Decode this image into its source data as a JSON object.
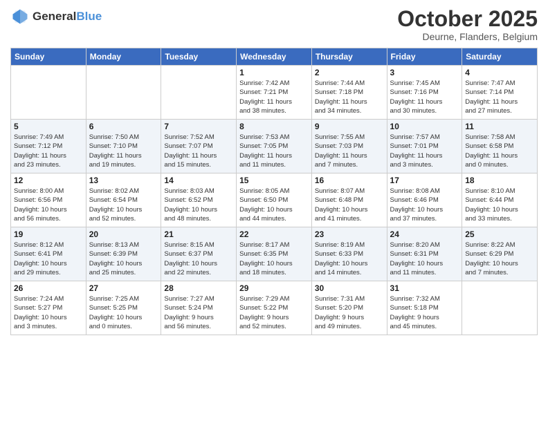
{
  "header": {
    "logo_line1": "General",
    "logo_line2": "Blue",
    "month_title": "October 2025",
    "subtitle": "Deurne, Flanders, Belgium"
  },
  "weekdays": [
    "Sunday",
    "Monday",
    "Tuesday",
    "Wednesday",
    "Thursday",
    "Friday",
    "Saturday"
  ],
  "weeks": [
    [
      {
        "day": "",
        "info": ""
      },
      {
        "day": "",
        "info": ""
      },
      {
        "day": "",
        "info": ""
      },
      {
        "day": "1",
        "info": "Sunrise: 7:42 AM\nSunset: 7:21 PM\nDaylight: 11 hours\nand 38 minutes."
      },
      {
        "day": "2",
        "info": "Sunrise: 7:44 AM\nSunset: 7:18 PM\nDaylight: 11 hours\nand 34 minutes."
      },
      {
        "day": "3",
        "info": "Sunrise: 7:45 AM\nSunset: 7:16 PM\nDaylight: 11 hours\nand 30 minutes."
      },
      {
        "day": "4",
        "info": "Sunrise: 7:47 AM\nSunset: 7:14 PM\nDaylight: 11 hours\nand 27 minutes."
      }
    ],
    [
      {
        "day": "5",
        "info": "Sunrise: 7:49 AM\nSunset: 7:12 PM\nDaylight: 11 hours\nand 23 minutes."
      },
      {
        "day": "6",
        "info": "Sunrise: 7:50 AM\nSunset: 7:10 PM\nDaylight: 11 hours\nand 19 minutes."
      },
      {
        "day": "7",
        "info": "Sunrise: 7:52 AM\nSunset: 7:07 PM\nDaylight: 11 hours\nand 15 minutes."
      },
      {
        "day": "8",
        "info": "Sunrise: 7:53 AM\nSunset: 7:05 PM\nDaylight: 11 hours\nand 11 minutes."
      },
      {
        "day": "9",
        "info": "Sunrise: 7:55 AM\nSunset: 7:03 PM\nDaylight: 11 hours\nand 7 minutes."
      },
      {
        "day": "10",
        "info": "Sunrise: 7:57 AM\nSunset: 7:01 PM\nDaylight: 11 hours\nand 3 minutes."
      },
      {
        "day": "11",
        "info": "Sunrise: 7:58 AM\nSunset: 6:58 PM\nDaylight: 11 hours\nand 0 minutes."
      }
    ],
    [
      {
        "day": "12",
        "info": "Sunrise: 8:00 AM\nSunset: 6:56 PM\nDaylight: 10 hours\nand 56 minutes."
      },
      {
        "day": "13",
        "info": "Sunrise: 8:02 AM\nSunset: 6:54 PM\nDaylight: 10 hours\nand 52 minutes."
      },
      {
        "day": "14",
        "info": "Sunrise: 8:03 AM\nSunset: 6:52 PM\nDaylight: 10 hours\nand 48 minutes."
      },
      {
        "day": "15",
        "info": "Sunrise: 8:05 AM\nSunset: 6:50 PM\nDaylight: 10 hours\nand 44 minutes."
      },
      {
        "day": "16",
        "info": "Sunrise: 8:07 AM\nSunset: 6:48 PM\nDaylight: 10 hours\nand 41 minutes."
      },
      {
        "day": "17",
        "info": "Sunrise: 8:08 AM\nSunset: 6:46 PM\nDaylight: 10 hours\nand 37 minutes."
      },
      {
        "day": "18",
        "info": "Sunrise: 8:10 AM\nSunset: 6:44 PM\nDaylight: 10 hours\nand 33 minutes."
      }
    ],
    [
      {
        "day": "19",
        "info": "Sunrise: 8:12 AM\nSunset: 6:41 PM\nDaylight: 10 hours\nand 29 minutes."
      },
      {
        "day": "20",
        "info": "Sunrise: 8:13 AM\nSunset: 6:39 PM\nDaylight: 10 hours\nand 25 minutes."
      },
      {
        "day": "21",
        "info": "Sunrise: 8:15 AM\nSunset: 6:37 PM\nDaylight: 10 hours\nand 22 minutes."
      },
      {
        "day": "22",
        "info": "Sunrise: 8:17 AM\nSunset: 6:35 PM\nDaylight: 10 hours\nand 18 minutes."
      },
      {
        "day": "23",
        "info": "Sunrise: 8:19 AM\nSunset: 6:33 PM\nDaylight: 10 hours\nand 14 minutes."
      },
      {
        "day": "24",
        "info": "Sunrise: 8:20 AM\nSunset: 6:31 PM\nDaylight: 10 hours\nand 11 minutes."
      },
      {
        "day": "25",
        "info": "Sunrise: 8:22 AM\nSunset: 6:29 PM\nDaylight: 10 hours\nand 7 minutes."
      }
    ],
    [
      {
        "day": "26",
        "info": "Sunrise: 7:24 AM\nSunset: 5:27 PM\nDaylight: 10 hours\nand 3 minutes."
      },
      {
        "day": "27",
        "info": "Sunrise: 7:25 AM\nSunset: 5:25 PM\nDaylight: 10 hours\nand 0 minutes."
      },
      {
        "day": "28",
        "info": "Sunrise: 7:27 AM\nSunset: 5:24 PM\nDaylight: 9 hours\nand 56 minutes."
      },
      {
        "day": "29",
        "info": "Sunrise: 7:29 AM\nSunset: 5:22 PM\nDaylight: 9 hours\nand 52 minutes."
      },
      {
        "day": "30",
        "info": "Sunrise: 7:31 AM\nSunset: 5:20 PM\nDaylight: 9 hours\nand 49 minutes."
      },
      {
        "day": "31",
        "info": "Sunrise: 7:32 AM\nSunset: 5:18 PM\nDaylight: 9 hours\nand 45 minutes."
      },
      {
        "day": "",
        "info": ""
      }
    ]
  ]
}
